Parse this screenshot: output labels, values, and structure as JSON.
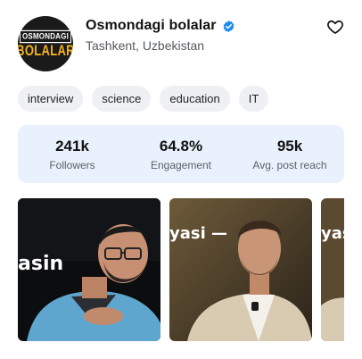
{
  "profile": {
    "name": "Osmondagi bolalar",
    "location": "Tashkent, Uzbekistan",
    "verified": true,
    "avatar_line1": "OSMONDAGI",
    "avatar_line2": "BOLALAR"
  },
  "tags": [
    "interview",
    "science",
    "education",
    "IT"
  ],
  "stats": [
    {
      "value": "241k",
      "label": "Followers"
    },
    {
      "value": "64.8%",
      "label": "Engagement"
    },
    {
      "value": "95k",
      "label": "Avg. post reach"
    }
  ],
  "media": {
    "thumb1_text": "asin",
    "thumb2_text": "yasi —",
    "thumb3_text": "yasi"
  },
  "icons": {
    "verified": "verified-badge-icon",
    "favorite": "heart-outline-icon"
  },
  "colors": {
    "verified_blue": "#1d8cf0",
    "stats_background": "#e9f1fc",
    "tag_background": "#eef0f3",
    "avatar_accent": "#f3b21b"
  }
}
